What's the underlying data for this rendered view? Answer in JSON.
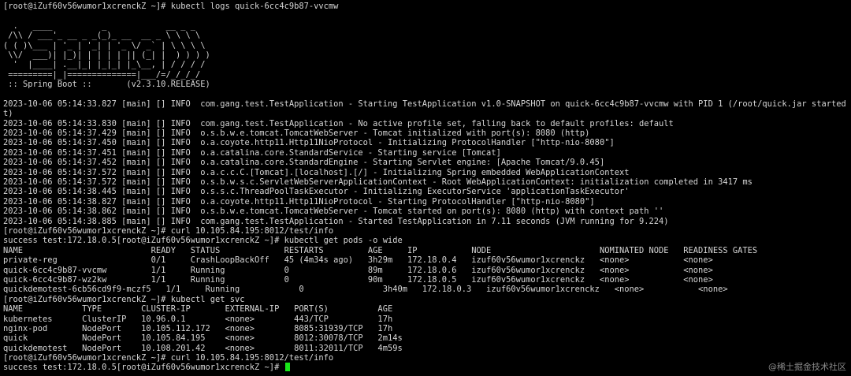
{
  "terminal": {
    "lines": [
      "[root@iZuf60v56wumor1xcrenckZ ~]# kubectl logs quick-6cc4c9b87-vvcmw",
      "",
      "  .   ____          _            __ _ _",
      " /\\\\ / ___'_ __ _ _(_)_ __  __ _ \\ \\ \\ \\",
      "( ( )\\___ | '_ | '_| | '_ \\/ _` | \\ \\ \\ \\",
      " \\\\/  ___)| |_)| | | | | || (_| |  ) ) ) )",
      "  '  |____| .__|_| |_|_| |_\\__, | / / / /",
      " =========|_|==============|___/=/_/_/_/",
      " :: Spring Boot ::       (v2.3.10.RELEASE)",
      "",
      "2023-10-06 05:14:33.827 [main] [] INFO  com.gang.test.TestApplication - Starting TestApplication v1.0-SNAPSHOT on quick-6cc4c9b87-vvcmw with PID 1 (/root/quick.jar started by root in /",
      "t)",
      "2023-10-06 05:14:33.830 [main] [] INFO  com.gang.test.TestApplication - No active profile set, falling back to default profiles: default",
      "2023-10-06 05:14:37.429 [main] [] INFO  o.s.b.w.e.tomcat.TomcatWebServer - Tomcat initialized with port(s): 8080 (http)",
      "2023-10-06 05:14:37.450 [main] [] INFO  o.a.coyote.http11.Http11NioProtocol - Initializing ProtocolHandler [\"http-nio-8080\"]",
      "2023-10-06 05:14:37.451 [main] [] INFO  o.a.catalina.core.StandardService - Starting service [Tomcat]",
      "2023-10-06 05:14:37.452 [main] [] INFO  o.a.catalina.core.StandardEngine - Starting Servlet engine: [Apache Tomcat/9.0.45]",
      "2023-10-06 05:14:37.572 [main] [] INFO  o.a.c.c.C.[Tomcat].[localhost].[/] - Initializing Spring embedded WebApplicationContext",
      "2023-10-06 05:14:37.572 [main] [] INFO  o.s.b.w.s.c.ServletWebServerApplicationContext - Root WebApplicationContext: initialization completed in 3417 ms",
      "2023-10-06 05:14:38.445 [main] [] INFO  o.s.s.c.ThreadPoolTaskExecutor - Initializing ExecutorService 'applicationTaskExecutor'",
      "2023-10-06 05:14:38.827 [main] [] INFO  o.a.coyote.http11.Http11NioProtocol - Starting ProtocolHandler [\"http-nio-8080\"]",
      "2023-10-06 05:14:38.862 [main] [] INFO  o.s.b.w.e.tomcat.TomcatWebServer - Tomcat started on port(s): 8080 (http) with context path ''",
      "2023-10-06 05:14:38.885 [main] [] INFO  com.gang.test.TestApplication - Started TestApplication in 7.11 seconds (JVM running for 9.224)",
      "[root@iZuf60v56wumor1xcrenckZ ~]# curl 10.105.84.195:8012/test/info",
      "success test:172.18.0.5[root@iZuf60v56wumor1xcrenckZ ~]# kubectl get pods -o wide",
      "NAME                          READY   STATUS             RESTARTS         AGE     IP           NODE                      NOMINATED NODE   READINESS GATES",
      "private-reg                   0/1     CrashLoopBackOff   45 (4m34s ago)   3h29m   172.18.0.4   izuf60v56wumor1xcrenckz   <none>           <none>",
      "quick-6cc4c9b87-vvcmw         1/1     Running            0                89m     172.18.0.6   izuf60v56wumor1xcrenckz   <none>           <none>",
      "quick-6cc4c9b87-wz2kw         1/1     Running            0                90m     172.18.0.5   izuf60v56wumor1xcrenckz   <none>           <none>",
      "quickdemotest-6cb56cd9f9-mczf5   1/1     Running            0                3h40m   172.18.0.3   izuf60v56wumor1xcrenckz   <none>           <none>",
      "[root@iZuf60v56wumor1xcrenckZ ~]# kubectl get svc",
      "NAME            TYPE        CLUSTER-IP       EXTERNAL-IP   PORT(S)          AGE",
      "kubernetes      ClusterIP   10.96.0.1        <none>        443/TCP          17h",
      "nginx-pod       NodePort    10.105.112.172   <none>        8085:31939/TCP   17h",
      "quick           NodePort    10.105.84.195    <none>        8012:30078/TCP   2m14s",
      "quickdemotest   NodePort    10.108.201.42    <none>        8011:32011/TCP   4m59s",
      "[root@iZuf60v56wumor1xcrenckZ ~]# curl 10.105.84.195:8012/test/info"
    ],
    "last_line": "success test:172.18.0.5[root@iZuf60v56wumor1xcrenckZ ~]# ",
    "cursor_color": "#19e619"
  },
  "watermark": "@稀土掘金技术社区"
}
